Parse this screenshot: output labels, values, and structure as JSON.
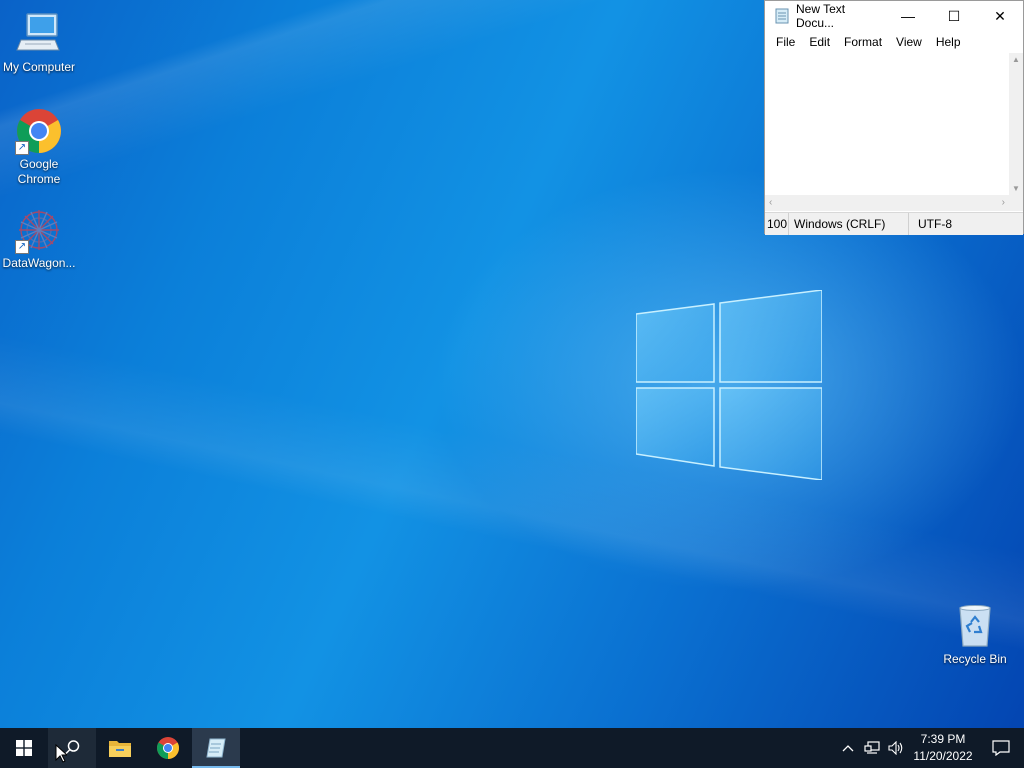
{
  "desktop": {
    "icons": [
      {
        "label": "My Computer"
      },
      {
        "label": "Google\nChrome"
      },
      {
        "label": "DataWagon..."
      },
      {
        "label": "Recycle Bin"
      }
    ]
  },
  "notepad": {
    "title": "New Text Docu...",
    "menu": [
      "File",
      "Edit",
      "Format",
      "View",
      "Help"
    ],
    "content": "",
    "status": {
      "zoom": "100",
      "line_ending": "Windows (CRLF)",
      "encoding": "UTF-8"
    },
    "controls": {
      "minimize": "—",
      "maximize": "☐",
      "close": "✕"
    }
  },
  "taskbar": {
    "clock_time": "7:39 PM",
    "clock_date": "11/20/2022",
    "apps": [
      "start",
      "search",
      "file-explorer",
      "google-chrome",
      "notepad"
    ],
    "active_app": "notepad"
  },
  "colors": {
    "taskbar": "#0f1a28",
    "desktop_accent": "#0b7fd9"
  }
}
